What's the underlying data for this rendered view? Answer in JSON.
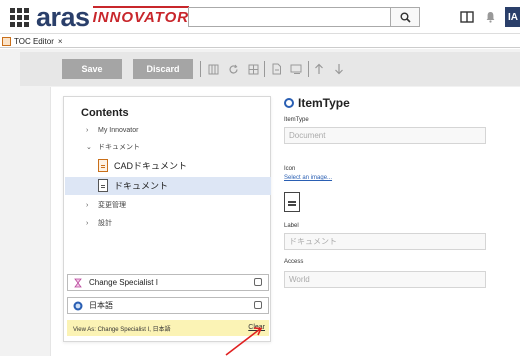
{
  "header": {
    "logo_main": "aras",
    "logo_sub": "INNOVATOR",
    "search_value": "",
    "avatar_text": "IA"
  },
  "tabs": [
    {
      "label": "TOC Editor",
      "close": "×"
    }
  ],
  "toolbar": {
    "save_label": "Save",
    "discard_label": "Discard"
  },
  "contents": {
    "title": "Contents",
    "items": [
      {
        "label": "My Innovator",
        "chevron": "›"
      },
      {
        "label": "ドキュメント",
        "chevron": "⌄"
      },
      {
        "label": "CADドキュメント"
      },
      {
        "label": "ドキュメント"
      },
      {
        "label": "変更管理",
        "chevron": "›"
      },
      {
        "label": "設計",
        "chevron": "›"
      }
    ],
    "identity": "Change Specialist I",
    "language": "日本語",
    "view_as": "View As: Change Specialist I, 日本語",
    "clear": "Clear"
  },
  "form": {
    "title": "ItemType",
    "itemtype_label": "ItemType",
    "itemtype_value": "Document",
    "icon_label": "Icon",
    "select_image": "Select an image...",
    "label_label": "Label",
    "label_value": "ドキュメント",
    "access_label": "Access",
    "access_value": "World"
  },
  "colors": {
    "brand_navy": "#2a3f6a",
    "brand_red": "#c8262b",
    "accent_blue": "#2a5fb3",
    "selected_row": "#dde6f5",
    "view_bar": "#fbf3b5"
  }
}
